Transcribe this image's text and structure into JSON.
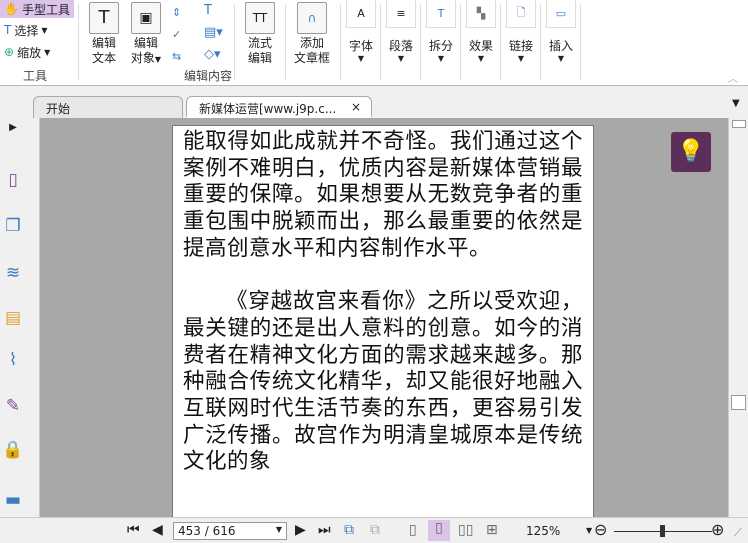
{
  "ribbon": {
    "tools": {
      "hand": "手型工具",
      "select": "选择",
      "zoom": "缩放",
      "group": "工具"
    },
    "edit": {
      "edit_text": [
        "编辑",
        "文本"
      ],
      "edit_object": [
        "编辑",
        "对象"
      ],
      "flow_edit": [
        "流式",
        "编辑"
      ],
      "add_frame": [
        "添加",
        "文章框"
      ],
      "group": "编辑内容"
    },
    "small": [
      {
        "label": "字体",
        "glyph": "A"
      },
      {
        "label": "段落",
        "glyph": "≡"
      },
      {
        "label": "拆分",
        "glyph": "T"
      },
      {
        "label": "效果",
        "glyph": "▚"
      },
      {
        "label": "链接",
        "glyph": "🗋"
      },
      {
        "label": "插入",
        "glyph": "▭"
      }
    ]
  },
  "tabs": [
    {
      "label": "开始"
    },
    {
      "label": "新媒体运营[www.j9p.c...",
      "close": "×"
    }
  ],
  "document": {
    "paragraphs": [
      "能取得如此成就并不奇怪。我们通过这个案例不难明白，优质内容是新媒体营销最重要的保障。如果想要从无数竞争者的重重包围中脱颖而出，那么最重要的依然是提高创意水平和内容制作水平。",
      "《穿越故宫来看你》之所以受欢迎，最关键的还是出人意料的创意。如今的消费者在精神文化方面的需求越来越多。那种融合传统文化精华，却又能很好地融入互联网时代生活节奏的东西，更容易引发广泛传播。故宫作为明清皇城原本是传统文化的象"
    ]
  },
  "status": {
    "page": "453 / 616",
    "zoom": "125%"
  },
  "colors": {
    "active_tool": "#dcc3ea",
    "bulb": "#5b2f5a",
    "doc_bg": "#a8a8a8"
  }
}
